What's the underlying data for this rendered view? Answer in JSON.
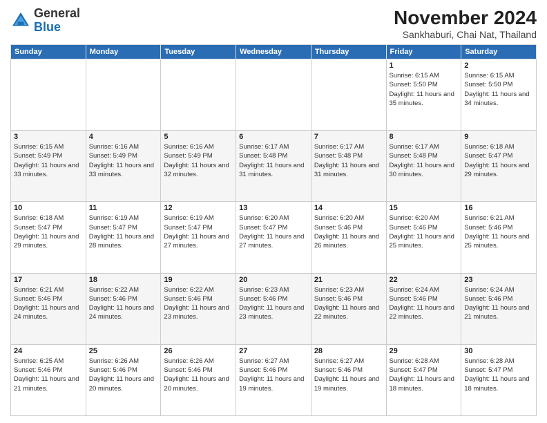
{
  "logo": {
    "general": "General",
    "blue": "Blue"
  },
  "header": {
    "month_title": "November 2024",
    "subtitle": "Sankhaburi, Chai Nat, Thailand"
  },
  "columns": [
    "Sunday",
    "Monday",
    "Tuesday",
    "Wednesday",
    "Thursday",
    "Friday",
    "Saturday"
  ],
  "weeks": [
    [
      {
        "day": "",
        "info": ""
      },
      {
        "day": "",
        "info": ""
      },
      {
        "day": "",
        "info": ""
      },
      {
        "day": "",
        "info": ""
      },
      {
        "day": "",
        "info": ""
      },
      {
        "day": "1",
        "info": "Sunrise: 6:15 AM\nSunset: 5:50 PM\nDaylight: 11 hours and 35 minutes."
      },
      {
        "day": "2",
        "info": "Sunrise: 6:15 AM\nSunset: 5:50 PM\nDaylight: 11 hours and 34 minutes."
      }
    ],
    [
      {
        "day": "3",
        "info": "Sunrise: 6:15 AM\nSunset: 5:49 PM\nDaylight: 11 hours and 33 minutes."
      },
      {
        "day": "4",
        "info": "Sunrise: 6:16 AM\nSunset: 5:49 PM\nDaylight: 11 hours and 33 minutes."
      },
      {
        "day": "5",
        "info": "Sunrise: 6:16 AM\nSunset: 5:49 PM\nDaylight: 11 hours and 32 minutes."
      },
      {
        "day": "6",
        "info": "Sunrise: 6:17 AM\nSunset: 5:48 PM\nDaylight: 11 hours and 31 minutes."
      },
      {
        "day": "7",
        "info": "Sunrise: 6:17 AM\nSunset: 5:48 PM\nDaylight: 11 hours and 31 minutes."
      },
      {
        "day": "8",
        "info": "Sunrise: 6:17 AM\nSunset: 5:48 PM\nDaylight: 11 hours and 30 minutes."
      },
      {
        "day": "9",
        "info": "Sunrise: 6:18 AM\nSunset: 5:47 PM\nDaylight: 11 hours and 29 minutes."
      }
    ],
    [
      {
        "day": "10",
        "info": "Sunrise: 6:18 AM\nSunset: 5:47 PM\nDaylight: 11 hours and 29 minutes."
      },
      {
        "day": "11",
        "info": "Sunrise: 6:19 AM\nSunset: 5:47 PM\nDaylight: 11 hours and 28 minutes."
      },
      {
        "day": "12",
        "info": "Sunrise: 6:19 AM\nSunset: 5:47 PM\nDaylight: 11 hours and 27 minutes."
      },
      {
        "day": "13",
        "info": "Sunrise: 6:20 AM\nSunset: 5:47 PM\nDaylight: 11 hours and 27 minutes."
      },
      {
        "day": "14",
        "info": "Sunrise: 6:20 AM\nSunset: 5:46 PM\nDaylight: 11 hours and 26 minutes."
      },
      {
        "day": "15",
        "info": "Sunrise: 6:20 AM\nSunset: 5:46 PM\nDaylight: 11 hours and 25 minutes."
      },
      {
        "day": "16",
        "info": "Sunrise: 6:21 AM\nSunset: 5:46 PM\nDaylight: 11 hours and 25 minutes."
      }
    ],
    [
      {
        "day": "17",
        "info": "Sunrise: 6:21 AM\nSunset: 5:46 PM\nDaylight: 11 hours and 24 minutes."
      },
      {
        "day": "18",
        "info": "Sunrise: 6:22 AM\nSunset: 5:46 PM\nDaylight: 11 hours and 24 minutes."
      },
      {
        "day": "19",
        "info": "Sunrise: 6:22 AM\nSunset: 5:46 PM\nDaylight: 11 hours and 23 minutes."
      },
      {
        "day": "20",
        "info": "Sunrise: 6:23 AM\nSunset: 5:46 PM\nDaylight: 11 hours and 23 minutes."
      },
      {
        "day": "21",
        "info": "Sunrise: 6:23 AM\nSunset: 5:46 PM\nDaylight: 11 hours and 22 minutes."
      },
      {
        "day": "22",
        "info": "Sunrise: 6:24 AM\nSunset: 5:46 PM\nDaylight: 11 hours and 22 minutes."
      },
      {
        "day": "23",
        "info": "Sunrise: 6:24 AM\nSunset: 5:46 PM\nDaylight: 11 hours and 21 minutes."
      }
    ],
    [
      {
        "day": "24",
        "info": "Sunrise: 6:25 AM\nSunset: 5:46 PM\nDaylight: 11 hours and 21 minutes."
      },
      {
        "day": "25",
        "info": "Sunrise: 6:26 AM\nSunset: 5:46 PM\nDaylight: 11 hours and 20 minutes."
      },
      {
        "day": "26",
        "info": "Sunrise: 6:26 AM\nSunset: 5:46 PM\nDaylight: 11 hours and 20 minutes."
      },
      {
        "day": "27",
        "info": "Sunrise: 6:27 AM\nSunset: 5:46 PM\nDaylight: 11 hours and 19 minutes."
      },
      {
        "day": "28",
        "info": "Sunrise: 6:27 AM\nSunset: 5:46 PM\nDaylight: 11 hours and 19 minutes."
      },
      {
        "day": "29",
        "info": "Sunrise: 6:28 AM\nSunset: 5:47 PM\nDaylight: 11 hours and 18 minutes."
      },
      {
        "day": "30",
        "info": "Sunrise: 6:28 AM\nSunset: 5:47 PM\nDaylight: 11 hours and 18 minutes."
      }
    ]
  ]
}
